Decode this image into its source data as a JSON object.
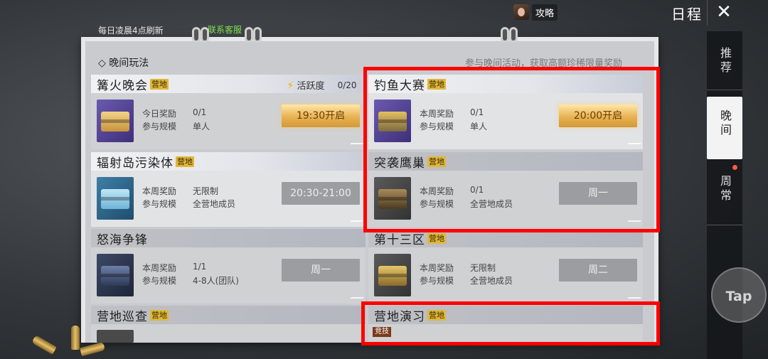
{
  "topbar": {
    "guide_label": "攻略",
    "title": "日程",
    "close_icon": "close-icon"
  },
  "sidenav": {
    "items": [
      {
        "label": "推荐",
        "active": false
      },
      {
        "label": "晚间",
        "active": true
      },
      {
        "label": "周常",
        "active": false
      }
    ]
  },
  "board": {
    "refresh_note": "每日凌晨4点刷新",
    "contact_link": "联系客服",
    "section_title": "◇ 晚间玩法",
    "section_subtitle": "参与晚间活动，获取高额珍稀限量奖励"
  },
  "labels": {
    "weekly_reward": "本周奖励",
    "daily_reward": "今日奖励",
    "scale": "参与规模",
    "tag": "营地",
    "activity": "活跃度",
    "activity_value": "0/20",
    "competitive_tag": "竞技"
  },
  "cards": [
    {
      "title": "篝火晚会",
      "reward_label": "今日奖励",
      "reward": "0/1",
      "scale": "单人",
      "button": "19:30开启",
      "icon": "gold-gift-box-icon"
    },
    {
      "title": "钓鱼大赛",
      "reward_label": "本周奖励",
      "reward": "0/1",
      "scale": "单人",
      "button": "20:00开启",
      "icon": "purple-supply-crate-icon"
    },
    {
      "title": "辐射岛污染体",
      "reward_label": "本周奖励",
      "reward": "无限制",
      "scale": "全营地成员",
      "button": "20:30-21:00",
      "icon": "blue-supply-crate-icon"
    },
    {
      "title": "突袭鹰巢",
      "reward_label": "本周奖励",
      "reward": "0/1",
      "scale": "全营地成员",
      "button": "周一",
      "icon": "brown-supply-crate-icon"
    },
    {
      "title": "怒海争锋",
      "reward_label": "本周奖励",
      "reward": "1/1",
      "scale": "4-8人(团队)",
      "button": "周一",
      "icon": "navy-supply-crate-icon"
    },
    {
      "title": "第十三区",
      "reward_label": "本周奖励",
      "reward": "无限制",
      "scale": "全营地成员",
      "button": "周二",
      "icon": "gold-supply-crate-icon"
    },
    {
      "title": "营地巡查",
      "icon": "card-thumb-icon"
    },
    {
      "title": "营地演习",
      "icon": "card-thumb-icon"
    }
  ],
  "tap_button": "Tap",
  "colors": {
    "highlight": "#ff0000",
    "tag": "#e0b73a",
    "contact": "#7ee04f",
    "gold_button": "#e7b254"
  }
}
